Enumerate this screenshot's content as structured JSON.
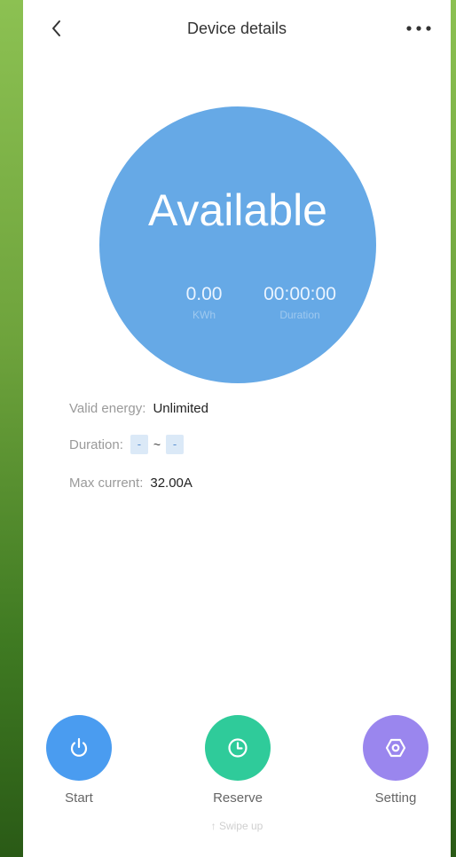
{
  "header": {
    "title": "Device details"
  },
  "status": {
    "label": "Available",
    "energy_value": "0.00",
    "energy_unit": "KWh",
    "duration_value": "00:00:00",
    "duration_label": "Duration",
    "circle_color": "#66a9e6"
  },
  "info": {
    "valid_energy_label": "Valid energy:",
    "valid_energy_value": "Unlimited",
    "duration_label": "Duration:",
    "duration_start": "-",
    "duration_separator": "~",
    "duration_end": "-",
    "max_current_label": "Max current:",
    "max_current_value": "32.00A"
  },
  "actions": [
    {
      "label": "Start",
      "icon": "power-icon",
      "color": "#4a9cf0"
    },
    {
      "label": "Reserve",
      "icon": "clock-icon",
      "color": "#2fcb9a"
    },
    {
      "label": "Setting",
      "icon": "settings-icon",
      "color": "#9a86ee"
    }
  ],
  "footer": {
    "swipe_hint": "↑ Swipe up"
  }
}
